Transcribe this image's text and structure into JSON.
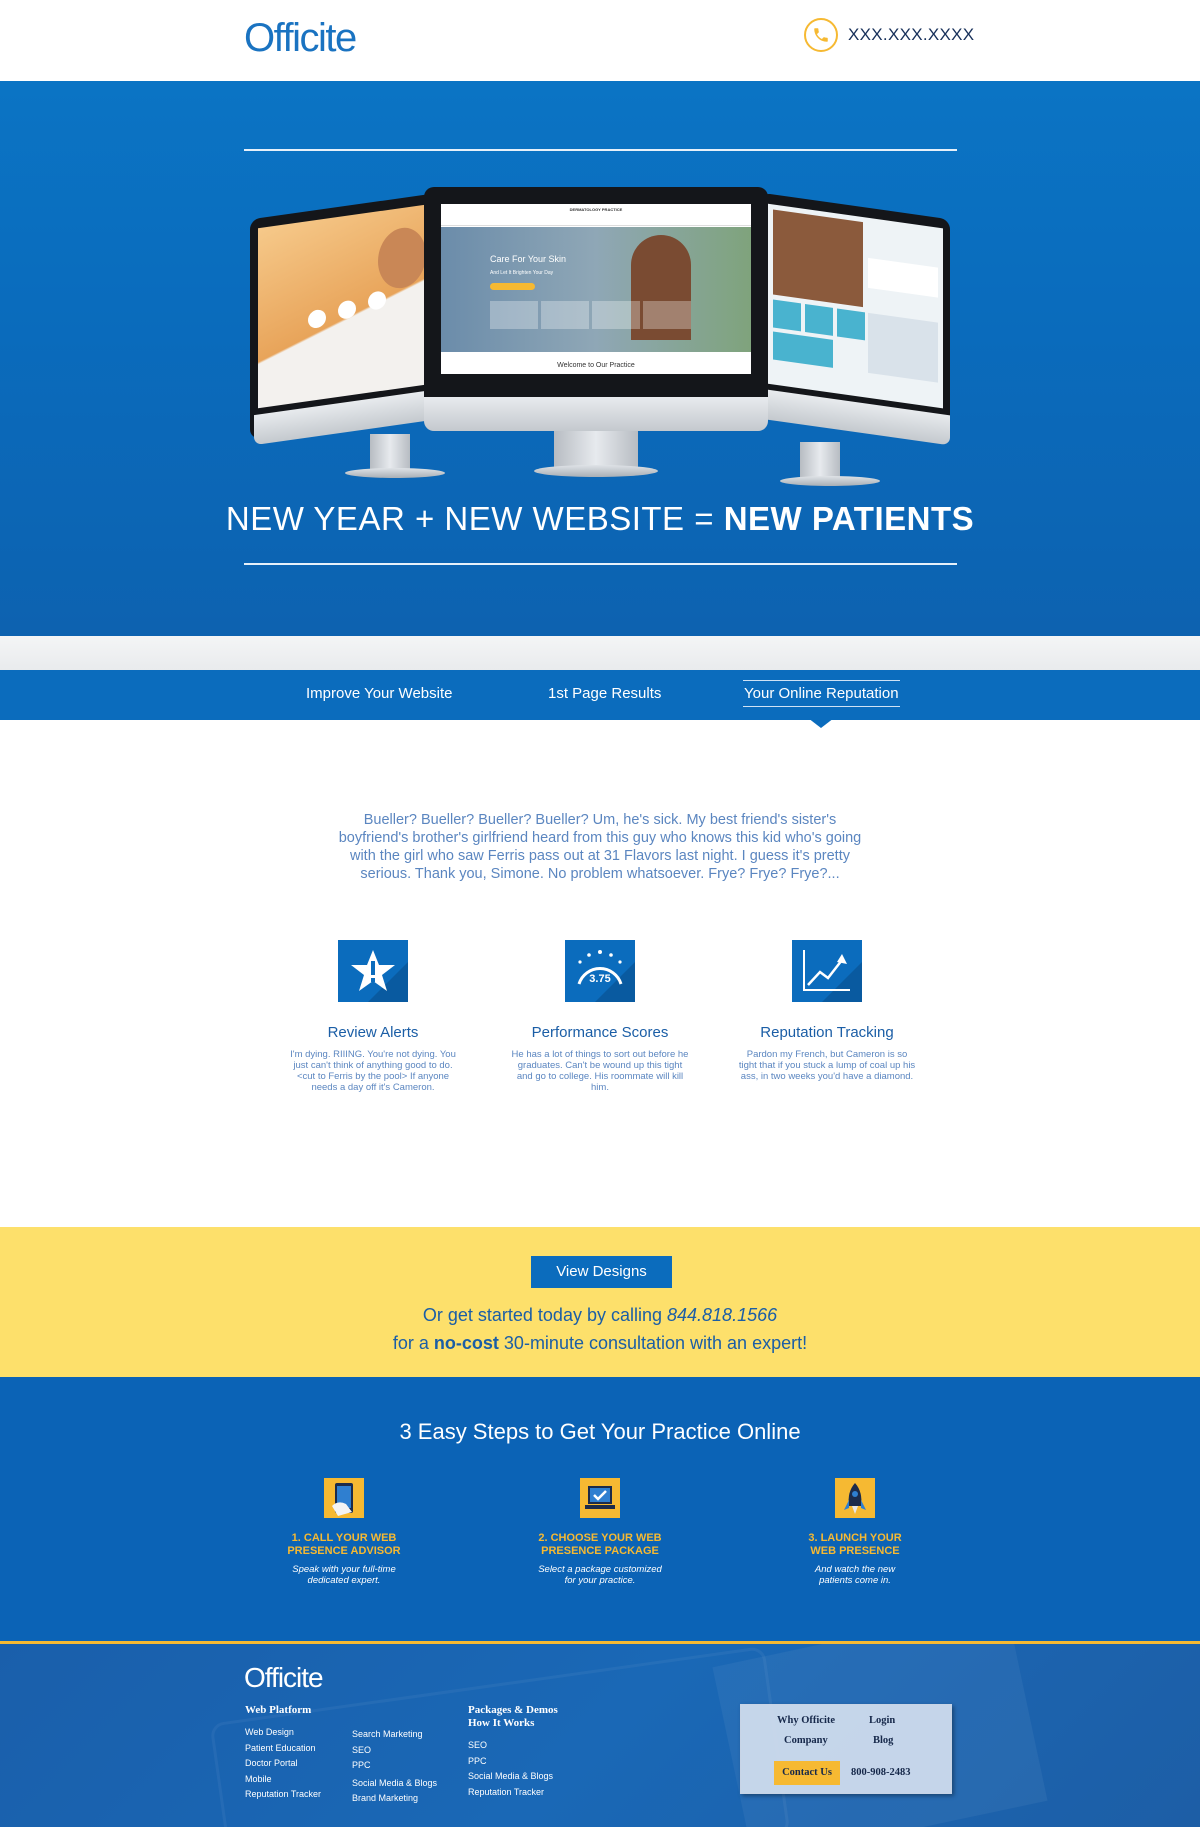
{
  "header": {
    "logo": "Officite",
    "phone": "XXX.XXX.XXXX"
  },
  "hero": {
    "title_light": "NEW YEAR + NEW WEBSITE = ",
    "title_bold": "NEW PATIENTS",
    "screen_center": {
      "brand": "DERMATOLOGY PRACTICE",
      "headline": "Care For Your Skin",
      "subline": "And Let It Brighten Your Day",
      "welcome": "Welcome to Our Practice"
    }
  },
  "tabs": [
    {
      "label": "Improve Your Website"
    },
    {
      "label": "1st Page Results"
    },
    {
      "label": "Your Online Reputation",
      "active": true
    }
  ],
  "intro": "Bueller? Bueller? Bueller? Bueller? Um, he's sick. My best friend's sister's boyfriend's brother's girlfriend heard from this guy who knows this kid who's going with the girl who saw Ferris pass out at 31 Flavors last night. I guess it's pretty serious. Thank you, Simone. No problem whatsoever. Frye? Frye? Frye?...",
  "features": [
    {
      "icon": "star-alert-icon",
      "title": "Review Alerts",
      "text": "I'm dying. RIIING. You're not dying. You just can't think of anything good to do. <cut to Ferris by the pool> If anyone needs a day off it's Cameron."
    },
    {
      "icon": "score-gauge-icon",
      "score": "3.75",
      "title": "Performance Scores",
      "text": "He has a lot of things to sort out before he graduates. Can't be wound up this tight and go to college. His roommate will kill him."
    },
    {
      "icon": "trend-chart-icon",
      "title": "Reputation Tracking",
      "text": "Pardon my French, but Cameron is so tight that if you stuck a lump of coal up his ass, in two weeks you'd have a diamond."
    }
  ],
  "cta": {
    "button": "View Designs",
    "line1_prefix": "Or get started today by calling ",
    "line1_phone": "844.818.1566",
    "line2_prefix": "for a ",
    "line2_bold": "no-cost",
    "line2_suffix": " 30-minute consultation with an expert!"
  },
  "steps": {
    "title": "3 Easy Steps to Get Your Practice Online",
    "items": [
      {
        "icon": "phone-hand-icon",
        "title_l1": "1. CALL YOUR WEB",
        "title_l2": "PRESENCE ADVISOR",
        "text_l1": "Speak with your full-time",
        "text_l2": "dedicated expert."
      },
      {
        "icon": "laptop-check-icon",
        "title_l1": "2. CHOOSE YOUR WEB",
        "title_l2": "PRESENCE PACKAGE",
        "text_l1": "Select a package customized",
        "text_l2": "for your practice."
      },
      {
        "icon": "rocket-icon",
        "title_l1": "3. LAUNCH YOUR",
        "title_l2": "WEB PRESENCE",
        "text_l1": "And watch the new",
        "text_l2": "patients come in."
      }
    ]
  },
  "footer": {
    "logo": "Officite",
    "col1_head": "Web Platform",
    "col1_links": [
      "Web Design",
      "Patient Education",
      "Doctor Portal",
      "Mobile",
      "Reputation Tracker"
    ],
    "col2_links": [
      "Search Marketing",
      "SEO",
      "PPC",
      "Social Media & Blogs",
      "Brand Marketing"
    ],
    "col3_head1": "Packages & Demos",
    "col3_head2": "How It Works",
    "col3_links": [
      "SEO",
      "PPC",
      "Social Media & Blogs",
      "Reputation Tracker"
    ],
    "box": {
      "why": "Why Officite",
      "login": "Login",
      "company": "Company",
      "blog": "Blog",
      "contact": "Contact Us",
      "phone": "800-908-2483"
    }
  },
  "colors": {
    "brand_blue": "#0b6cbd",
    "accent_yellow": "#f6b932",
    "cta_yellow": "#fde06b"
  }
}
